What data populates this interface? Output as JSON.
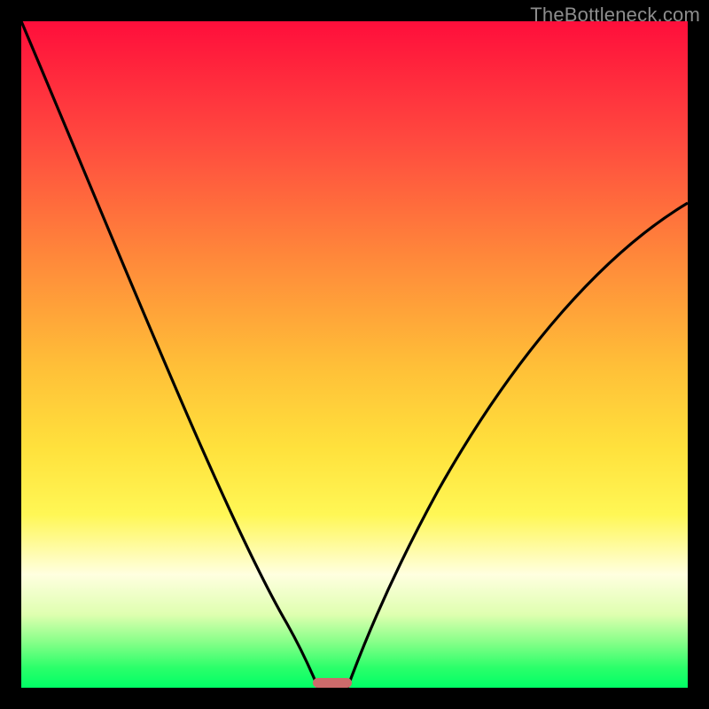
{
  "watermark": "TheBottleneck.com",
  "chart_data": {
    "type": "line",
    "title": "",
    "xlabel": "",
    "ylabel": "",
    "xlim": [
      0,
      1
    ],
    "ylim": [
      0,
      1
    ],
    "series": [
      {
        "name": "left-curve",
        "x": [
          0.0,
          0.05,
          0.1,
          0.15,
          0.2,
          0.25,
          0.3,
          0.35,
          0.4,
          0.425,
          0.445
        ],
        "y": [
          1.0,
          0.83,
          0.67,
          0.53,
          0.41,
          0.3,
          0.21,
          0.13,
          0.06,
          0.025,
          0.0
        ]
      },
      {
        "name": "right-curve",
        "x": [
          0.49,
          0.52,
          0.56,
          0.6,
          0.65,
          0.7,
          0.75,
          0.8,
          0.85,
          0.9,
          0.95,
          1.0
        ],
        "y": [
          0.0,
          0.06,
          0.14,
          0.22,
          0.31,
          0.4,
          0.48,
          0.55,
          0.61,
          0.66,
          0.7,
          0.73
        ]
      }
    ],
    "marker": {
      "x_center": 0.467,
      "width": 0.058,
      "y": 0.0
    },
    "background": {
      "gradient_top": "#ff0e3b",
      "gradient_bottom": "#00ff66"
    }
  }
}
